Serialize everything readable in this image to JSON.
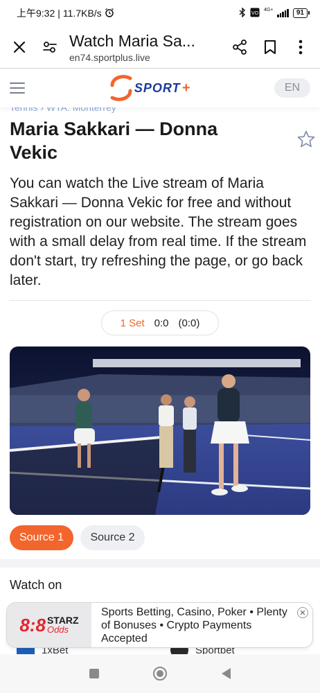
{
  "status_bar": {
    "time": "上午9:32",
    "speed": "11.7KB/s",
    "network": "4G+",
    "battery": "91"
  },
  "browser": {
    "page_title": "Watch Maria Sa...",
    "host": "en74.sportplus.live"
  },
  "site": {
    "logo_text": "SPORT",
    "logo_plus": "+",
    "language": "EN"
  },
  "match": {
    "breadcrumb": "Tennis  ›  WTA. Monterrey",
    "title": "Maria Sakkari — Donna Vekic",
    "description": "You can watch the Live stream of Maria Sakkari — Donna Vekic for free and without registration on our website. The stream goes with a small delay from real time. If the stream don't start, try refreshing the page, or go back later.",
    "score": {
      "set_label": "1 Set",
      "games": "0:0",
      "points": "(0:0)"
    }
  },
  "sources": [
    "Source 1",
    "Source 2"
  ],
  "watch_on": {
    "heading": "Watch on",
    "bookmakers": [
      "1xBet",
      "Sportbet"
    ]
  },
  "ad": {
    "brand_main": "8:8",
    "brand_starz": "STARZ",
    "brand_odds": "Odds",
    "text": "Sports Betting, Casino, Poker • Plenty of Bonuses • Crypto Payments Accepted"
  },
  "colors": {
    "accent": "#f2652c",
    "brand_blue": "#1b3a9e"
  }
}
